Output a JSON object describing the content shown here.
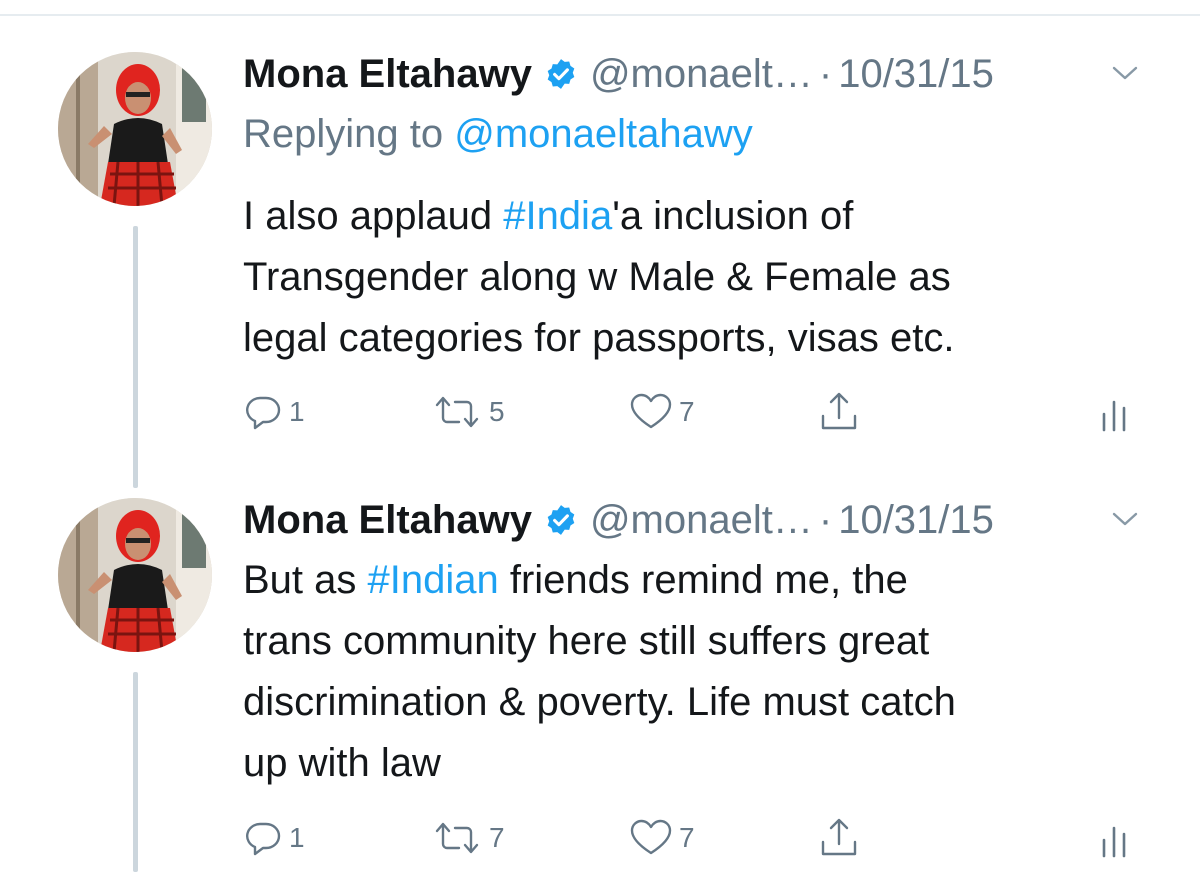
{
  "tweets": [
    {
      "name": "Mona Eltahawy",
      "handle": "@monaelt…",
      "separator": "·",
      "date": "10/31/15",
      "replying_prefix": "Replying to ",
      "replying_to": "@monaeltahawy",
      "text_lines": [
        {
          "before": "I also applaud ",
          "hashtag": "#India",
          "after": "'a inclusion of"
        },
        {
          "text": "Transgender along w Male & Female as"
        },
        {
          "text": "legal categories for passports, visas etc."
        }
      ],
      "reply_count": "1",
      "retweet_count": "5",
      "like_count": "7"
    },
    {
      "name": "Mona Eltahawy",
      "handle": "@monaelt…",
      "separator": "·",
      "date": "10/31/15",
      "text_lines": [
        {
          "before": "But as ",
          "hashtag": "#Indian",
          "after": " friends remind me, the"
        },
        {
          "text": "trans community here still suffers great"
        },
        {
          "text": "discrimination & poverty. Life must catch"
        },
        {
          "text": "up with law"
        }
      ],
      "reply_count": "1",
      "retweet_count": "7",
      "like_count": "7"
    }
  ],
  "icons": {
    "verified": "verified-badge-icon",
    "caret": "chevron-down-icon",
    "reply": "reply-bubble-icon",
    "retweet": "retweet-arrows-icon",
    "like": "heart-outline-icon",
    "share": "share-upload-icon",
    "analytics": "analytics-bars-icon"
  },
  "colors": {
    "link": "#1da1f2",
    "secondary": "#657786",
    "text": "#14171a",
    "thread_line": "#ccd6dd"
  }
}
